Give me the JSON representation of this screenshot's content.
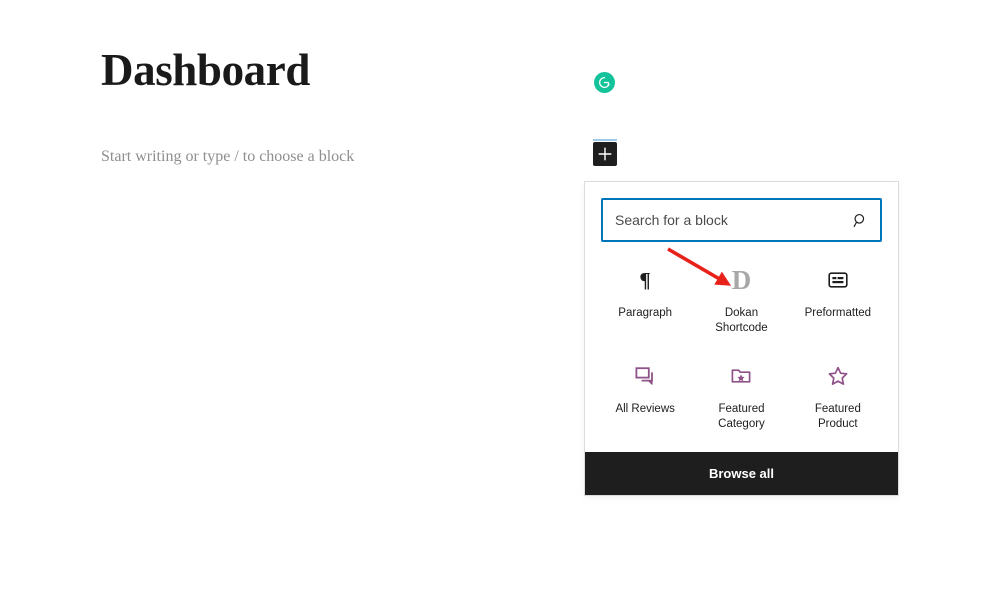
{
  "editor": {
    "post_title": "Dashboard",
    "paragraph_placeholder": "Start writing or type / to choose a block"
  },
  "grammarly": {
    "icon": "grammarly-icon",
    "color": "#15c39a",
    "letter": "G"
  },
  "inserter_toggle": {
    "icon": "plus-icon",
    "background": "#1e1e1e",
    "indicator_color": "#9ec9e8"
  },
  "inserter": {
    "search": {
      "placeholder": "Search for a block",
      "value": "",
      "icon": "search-icon",
      "border_color": "#0076ba"
    },
    "blocks": [
      {
        "label": "Paragraph",
        "icon": "paragraph-pilcrow-icon",
        "color": "#1e1e1e"
      },
      {
        "label": "Dokan Shortcode",
        "icon": "dokan-d-icon",
        "color": "#a8a8a8",
        "glyph": "D"
      },
      {
        "label": "Preformatted",
        "icon": "preformatted-icon",
        "color": "#1e1e1e"
      },
      {
        "label": "All Reviews",
        "icon": "comments-icon",
        "color": "#8f5389"
      },
      {
        "label": "Featured Category",
        "icon": "folder-star-icon",
        "color": "#8f5389"
      },
      {
        "label": "Featured Product",
        "icon": "star-outline-icon",
        "color": "#8f5389"
      }
    ],
    "browse_all_label": "Browse all"
  },
  "annotation": {
    "arrow": "red-arrow-pointing-to-dokan-shortcode",
    "color": "#e8211a"
  }
}
